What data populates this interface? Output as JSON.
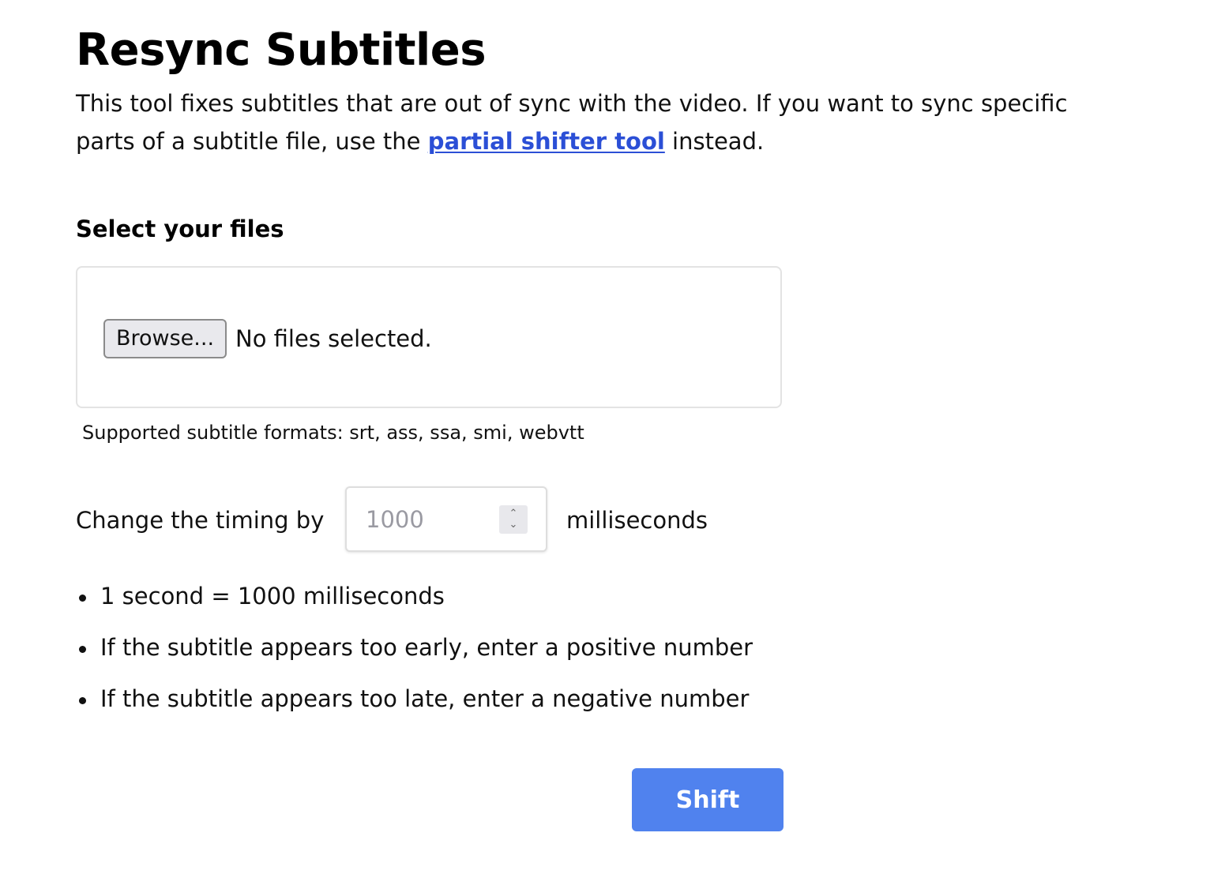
{
  "page": {
    "title": "Resync Subtitles",
    "intro_before_link": "This tool fixes subtitles that are out of sync with the video. If you want to sync specific parts of a subtitle file, use the ",
    "intro_link": "partial shifter tool",
    "intro_after_link": " instead."
  },
  "file_section": {
    "label": "Select your files",
    "browse_label": "Browse...",
    "status": "No files selected.",
    "formats_note": "Supported subtitle formats: srt, ass, ssa, smi, webvtt"
  },
  "timing": {
    "label": "Change the timing by",
    "placeholder": "1000",
    "units": "milliseconds"
  },
  "tips": [
    "1 second = 1000 milliseconds",
    "If the subtitle appears too early, enter a positive number",
    "If the subtitle appears too late, enter a negative number"
  ],
  "actions": {
    "shift_label": "Shift"
  },
  "colors": {
    "link": "#2b4fd6",
    "primary_button": "#5082ee"
  },
  "icons": {
    "spinner": "up-down-spinner-icon"
  }
}
